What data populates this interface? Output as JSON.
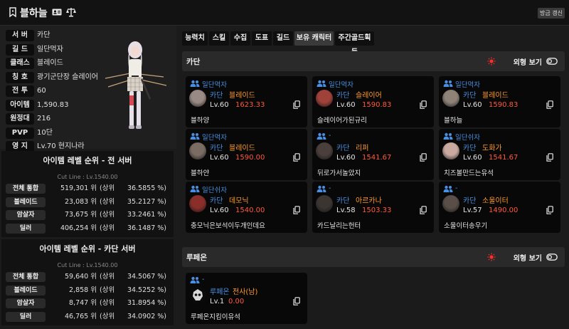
{
  "header": {
    "name": "블하늘",
    "refresh_label": "방금 갱신"
  },
  "profile": {
    "rows": [
      {
        "label": "서 버",
        "value": "카단"
      },
      {
        "label": "길 드",
        "value": "일단먹자"
      },
      {
        "label": "클래스",
        "value": "블레이드"
      },
      {
        "label": "칭 호",
        "value": "광기군단장 슬레이어"
      },
      {
        "label": "전 투",
        "value": "60"
      },
      {
        "label": "아이템",
        "value": "1,590.83"
      },
      {
        "label": "원정대",
        "value": "216"
      },
      {
        "label": "PVP",
        "value": "10단"
      },
      {
        "label": "영 지",
        "value": "Lv.70 현지나라"
      }
    ]
  },
  "ranking_all": {
    "title": "아이템 레벨 순위 - 전 서버",
    "cutline": "Cut Line : Lv.1540.00",
    "rows": [
      {
        "label": "전체 통합",
        "rank": "519,301 위",
        "top": "(상위",
        "pct": "36.5855 %)"
      },
      {
        "label": "블레이드",
        "rank": "23,083 위",
        "top": "(상위",
        "pct": "35.2127 %)"
      },
      {
        "label": "암살자",
        "rank": "73,675 위",
        "top": "(상위",
        "pct": "33.2461 %)"
      },
      {
        "label": "딜러",
        "rank": "406,254 위",
        "top": "(상위",
        "pct": "36.1487 %)"
      }
    ]
  },
  "ranking_server": {
    "title": "아이템 레벨 순위 - 카단 서버",
    "cutline": "Cut Line : Lv.1540.00",
    "rows": [
      {
        "label": "전체 통합",
        "rank": "59,640 위",
        "top": "(상위",
        "pct": "34.5067 %)"
      },
      {
        "label": "블레이드",
        "rank": "2,858 위",
        "top": "(상위",
        "pct": "34.5252 %)"
      },
      {
        "label": "암살자",
        "rank": "8,747 위",
        "top": "(상위",
        "pct": "31.8954 %)"
      },
      {
        "label": "딜러",
        "rank": "46,765 위",
        "top": "(상위",
        "pct": "34.0902 %)"
      }
    ]
  },
  "tabs": [
    "능력치",
    "스킬",
    "수집",
    "도표",
    "길드",
    "보유 캐릭터",
    "주간골드획득"
  ],
  "active_tab": "보유 캐릭터",
  "appearance_label": "외형 보기",
  "sections": [
    {
      "title": "카단",
      "cards": [
        {
          "guild": "일단먹자",
          "server": "카단",
          "class": "블레이드",
          "level": "Lv.60",
          "ilvl": "1623.33",
          "name": "블하양",
          "avatar": "#9a8a86"
        },
        {
          "guild": "일단먹자",
          "server": "카단",
          "class": "슬레이어",
          "level": "Lv.60",
          "ilvl": "1590.83",
          "name": "슬레이어가된규리",
          "avatar": "#a0413a"
        },
        {
          "guild": "일단먹자",
          "server": "카단",
          "class": "블레이드",
          "level": "Lv.60",
          "ilvl": "1590.83",
          "name": "블하늘",
          "avatar": "#8f8378"
        },
        {
          "guild": "일단먹자",
          "server": "카단",
          "class": "블레이드",
          "level": "Lv.60",
          "ilvl": "1590.00",
          "name": "블하얀",
          "avatar": "#7a6c62"
        },
        {
          "guild": "-",
          "server": "카단",
          "class": "리퍼",
          "level": "Lv.60",
          "ilvl": "1541.67",
          "name": "뒤로가서놀았지",
          "avatar": "#4a3f3b"
        },
        {
          "guild": "일단쉬자",
          "server": "카단",
          "class": "도화가",
          "level": "Lv.60",
          "ilvl": "1541.67",
          "name": "치즈볼만드는유석",
          "avatar": "#c9a9a0"
        },
        {
          "guild": "일단쉬자",
          "server": "카단",
          "class": "데모닉",
          "level": "Lv.60",
          "ilvl": "1540.00",
          "name": "충모닉은보석이두개인데요",
          "avatar": "#8a2e2a"
        },
        {
          "guild": "-",
          "server": "카단",
          "class": "아르카나",
          "level": "Lv.58",
          "ilvl": "1503.33",
          "name": "카드날리는헌터",
          "avatar": "#3b3532"
        },
        {
          "guild": "-",
          "server": "카단",
          "class": "소울이터",
          "level": "Lv.57",
          "ilvl": "1490.00",
          "name": "소울이터송우기",
          "avatar": "#5a4e48"
        }
      ]
    },
    {
      "title": "루페온",
      "cards": [
        {
          "guild": "-",
          "server": "루페온",
          "class": "전사(남)",
          "level": "Lv.1",
          "ilvl": "0.00",
          "name": "루페온지킴이유석",
          "avatar": "#2c2c2c"
        }
      ]
    }
  ]
}
